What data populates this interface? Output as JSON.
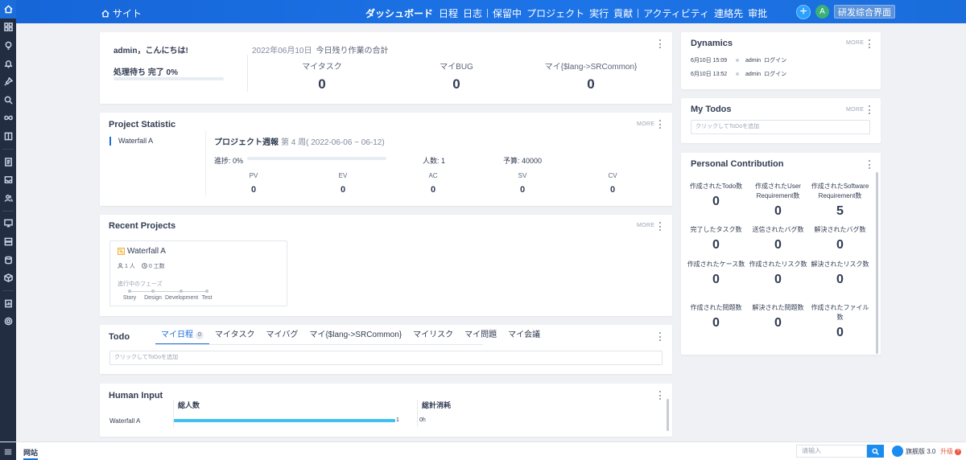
{
  "topbar": {
    "site_label": "サイト",
    "nav": [
      "ダッシュボード",
      "日程",
      "日志",
      "保留中",
      "プロジェクト",
      "実行",
      "貢献",
      "アクティビティ",
      "連絡先",
      "审批"
    ],
    "avatar_letter": "A",
    "rd_label": "研发综合界面"
  },
  "welcome": {
    "greeting": "admin，こんにちは!",
    "pending": "処理待ち 完了 0%",
    "date": "2022年06月10日",
    "summary_label": "今日残り作業の合計",
    "stats": [
      {
        "label": "マイタスク",
        "value": "0"
      },
      {
        "label": "マイBUG",
        "value": "0"
      },
      {
        "label": "マイ{$lang->SRCommon}",
        "value": "0"
      }
    ]
  },
  "project_statistic": {
    "title": "Project Statistic",
    "more": "MORE",
    "project": "Waterfall A",
    "weekly_title": "プロジェクト週報",
    "week": "第 4 周( 2022-06-06 ~ 06-12)",
    "progress": "進捗:  0%",
    "people": "人数:  1",
    "budget": "予算:  40000",
    "columns": [
      {
        "label": "PV",
        "value": "0"
      },
      {
        "label": "EV",
        "value": "0"
      },
      {
        "label": "AC",
        "value": "0"
      },
      {
        "label": "SV",
        "value": "0"
      },
      {
        "label": "CV",
        "value": "0"
      }
    ]
  },
  "recent_projects": {
    "title": "Recent Projects",
    "more": "MORE",
    "card": {
      "name": "Waterfall A",
      "members": "1 人",
      "hours": "0 工数",
      "phase_label": "進行中のフェーズ",
      "steps": [
        "Story",
        "Design",
        "Development",
        "Test"
      ]
    }
  },
  "todo": {
    "title": "Todo",
    "tabs": [
      {
        "label": "マイ日程",
        "badge": "0"
      },
      {
        "label": "マイタスク"
      },
      {
        "label": "マイバグ"
      },
      {
        "label": "マイ{$lang->SRCommon}"
      },
      {
        "label": "マイリスク"
      },
      {
        "label": "マイ問題"
      },
      {
        "label": "マイ会議"
      }
    ],
    "placeholder": "クリックしてToDoを追加"
  },
  "human_input": {
    "title": "Human Input",
    "col1": "総人数",
    "col2": "総計消耗",
    "row_name": "Waterfall A",
    "bar_value": "1",
    "consumed": "0h",
    "bar_fill": 1.0
  },
  "dynamics": {
    "title": "Dynamics",
    "more": "MORE",
    "items": [
      {
        "time": "6月10日 15:09",
        "user": "admin",
        "action": "ログイン"
      },
      {
        "time": "6月10日 13:52",
        "user": "admin",
        "action": "ログイン"
      }
    ]
  },
  "my_todos": {
    "title": "My Todos",
    "more": "MORE",
    "placeholder": "クリックしてToDoを追加"
  },
  "personal_contribution": {
    "title": "Personal Contribution",
    "cells": [
      {
        "label": "作成されたTodo数",
        "value": "0"
      },
      {
        "label": "作成されたUser Requirement数",
        "value": "0"
      },
      {
        "label": "作成されたSoftware Requirement数",
        "value": "5"
      },
      {
        "label": "完了したタスク数",
        "value": "0"
      },
      {
        "label": "送信されたバグ数",
        "value": "0"
      },
      {
        "label": "解決されたバグ数",
        "value": "0"
      },
      {
        "label": "作成されたケース数",
        "value": "0"
      },
      {
        "label": "作成されたリスク数",
        "value": "0"
      },
      {
        "label": "解決されたリスク数",
        "value": "0"
      },
      {
        "label": "作成された問題数",
        "value": "0"
      },
      {
        "label": "解決された問題数",
        "value": "0"
      },
      {
        "label": "作成されたファイル数",
        "value": "0"
      }
    ]
  },
  "bottom": {
    "site_tab": "网站",
    "search_placeholder": "请输入",
    "version": "旗舰版 3.0",
    "upgrade": "升级"
  }
}
